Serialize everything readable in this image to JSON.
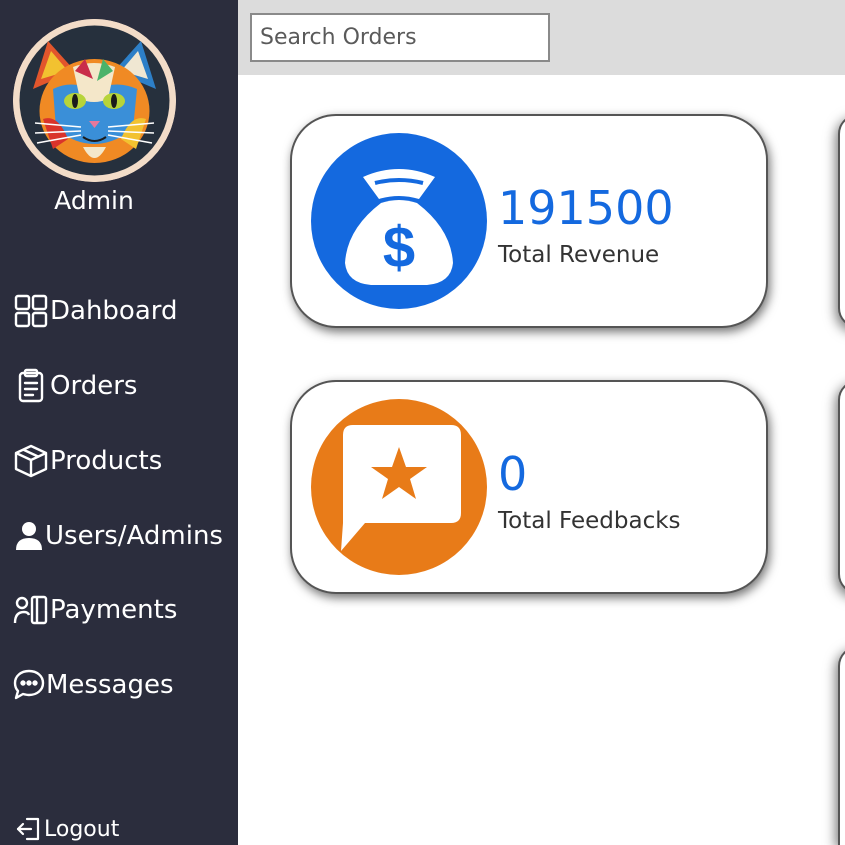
{
  "sidebar": {
    "admin_name": "Admin",
    "items": [
      {
        "label": "Dahboard",
        "icon": "grid-icon"
      },
      {
        "label": "Orders",
        "icon": "clipboard-icon"
      },
      {
        "label": "Products",
        "icon": "box-icon"
      },
      {
        "label": "Users/Admins",
        "icon": "user-icon"
      },
      {
        "label": "Payments",
        "icon": "payment-icon"
      },
      {
        "label": "Messages",
        "icon": "chat-icon"
      }
    ],
    "logout_label": "Logout"
  },
  "search": {
    "placeholder": "Search Orders"
  },
  "cards": [
    {
      "value": "191500",
      "label": "Total Revenue",
      "icon": "money-bag-icon",
      "color": "#1469df"
    },
    {
      "value": "0",
      "label": "Total Feedbacks",
      "icon": "feedback-star-icon",
      "color": "#e87b18"
    }
  ],
  "colors": {
    "sidebar_bg": "#2b2d3d",
    "topbar_bg": "#dcdcdc",
    "revenue_accent": "#1469df",
    "feedback_accent": "#e87b18"
  }
}
